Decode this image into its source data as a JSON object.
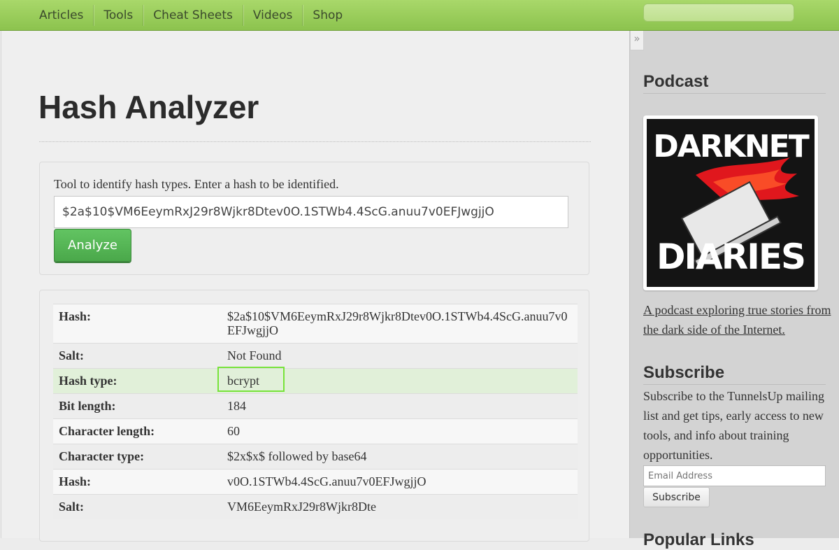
{
  "nav": {
    "items": [
      "Articles",
      "Tools",
      "Cheat Sheets",
      "Videos",
      "Shop"
    ],
    "search_placeholder": ""
  },
  "main": {
    "title": "Hash Analyzer",
    "intro": "Tool to identify hash types. Enter a hash to be identified.",
    "hash_input_value": "$2a$10$VM6EeymRxJ29r8Wjkr8Dtev0O.1STWb4.4ScG.anuu7v0EFJwgjjO",
    "analyze_label": "Analyze"
  },
  "results": [
    {
      "label": "Hash:",
      "value": "$2a$10$VM6EeymRxJ29r8Wjkr8Dtev0O.1STWb4.4ScG.anuu7v0EFJwgjjO"
    },
    {
      "label": "Salt:",
      "value": "Not Found"
    },
    {
      "label": "Hash type:",
      "value": "bcrypt"
    },
    {
      "label": "Bit length:",
      "value": "184"
    },
    {
      "label": "Character length:",
      "value": "60"
    },
    {
      "label": "Character type:",
      "value": "$2x$x$ followed by base64"
    },
    {
      "label": "Hash:",
      "value": "v0O.1STWb4.4ScG.anuu7v0EFJwgjjO"
    },
    {
      "label": "Salt:",
      "value": "VM6EeymRxJ29r8Wjkr8Dte"
    }
  ],
  "sidebar": {
    "collapse_glyph": "»",
    "podcast_heading": "Podcast",
    "podcast_logo_top": "DARKNET",
    "podcast_logo_bottom": "DIARIES",
    "podcast_link": "A podcast exploring true stories from the dark side of the Internet.",
    "subscribe_heading": "Subscribe",
    "subscribe_text": "Subscribe to the TunnelsUp mailing list and get tips, early access to new tools, and info about training opportunities.",
    "email_placeholder": "Email Address",
    "subscribe_button": "Subscribe",
    "popular_heading": "Popular Links"
  }
}
